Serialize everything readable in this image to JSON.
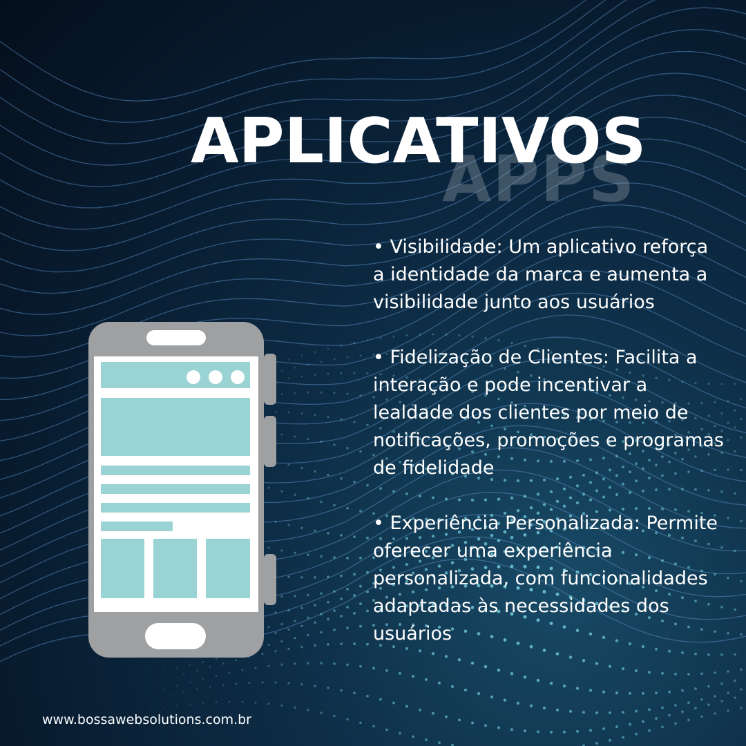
{
  "header": {
    "title": "APLICATIVOS",
    "subtitle": "APPS"
  },
  "points": [
    "• Visibilidade: Um aplicativo reforça a identidade da marca e aumenta a visibilidade junto aos usuários",
    "• Fidelização de Clientes: Facilita a interação e pode incentivar a lealdade dos clientes por meio de notificações, promoções e programas de fidelidade",
    "• Experiência Personalizada: Permite oferecer uma experiência personalizada, com funcionalidades adaptadas às necessidades dos usuários"
  ],
  "footer": {
    "website": "www.bossawebsolutions.com.br"
  },
  "icons": {
    "phone": "smartphone-icon"
  },
  "colors": {
    "background": "#081c30",
    "phone_body": "#9ea0a2",
    "screen_blocks": "#99d3d3",
    "title": "#ffffff"
  }
}
